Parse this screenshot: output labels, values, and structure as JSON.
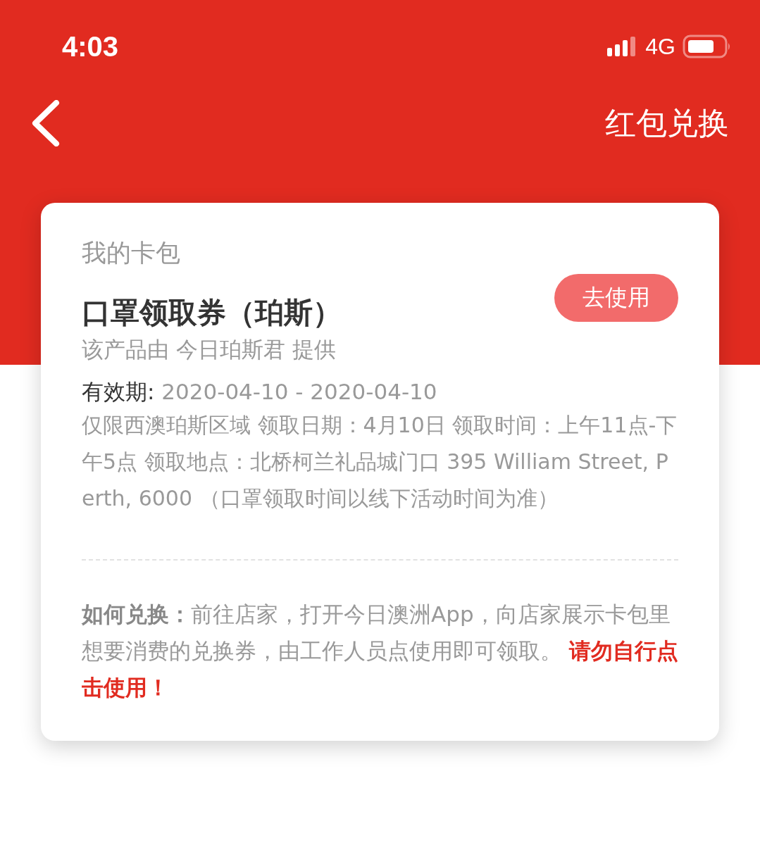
{
  "status_bar": {
    "time": "4:03",
    "network": "4G"
  },
  "nav_bar": {
    "title": "红包兑换"
  },
  "card": {
    "section_title": "我的卡包",
    "coupon_title": "口罩领取券（珀斯）",
    "action_button": "去使用",
    "provider": "该产品由 今日珀斯君 提供",
    "validity": {
      "label": "有效期:",
      "value": "2020-04-10 - 2020-04-10"
    },
    "description": "仅限西澳珀斯区域 领取日期：4月10日 领取时间：上午11点-下午5点 领取地点：北桥柯兰礼品城门口 395 William Street, Perth, 6000 （口罩领取时间以线下活动时间为准）",
    "how_to": "**如何兑换：**前往店家，打开今日澳洲App，向店家展示卡包里想要消费的兑换券，由工作人员点使用即可领取。",
    "warning": "请勿自行点击使用！"
  }
}
